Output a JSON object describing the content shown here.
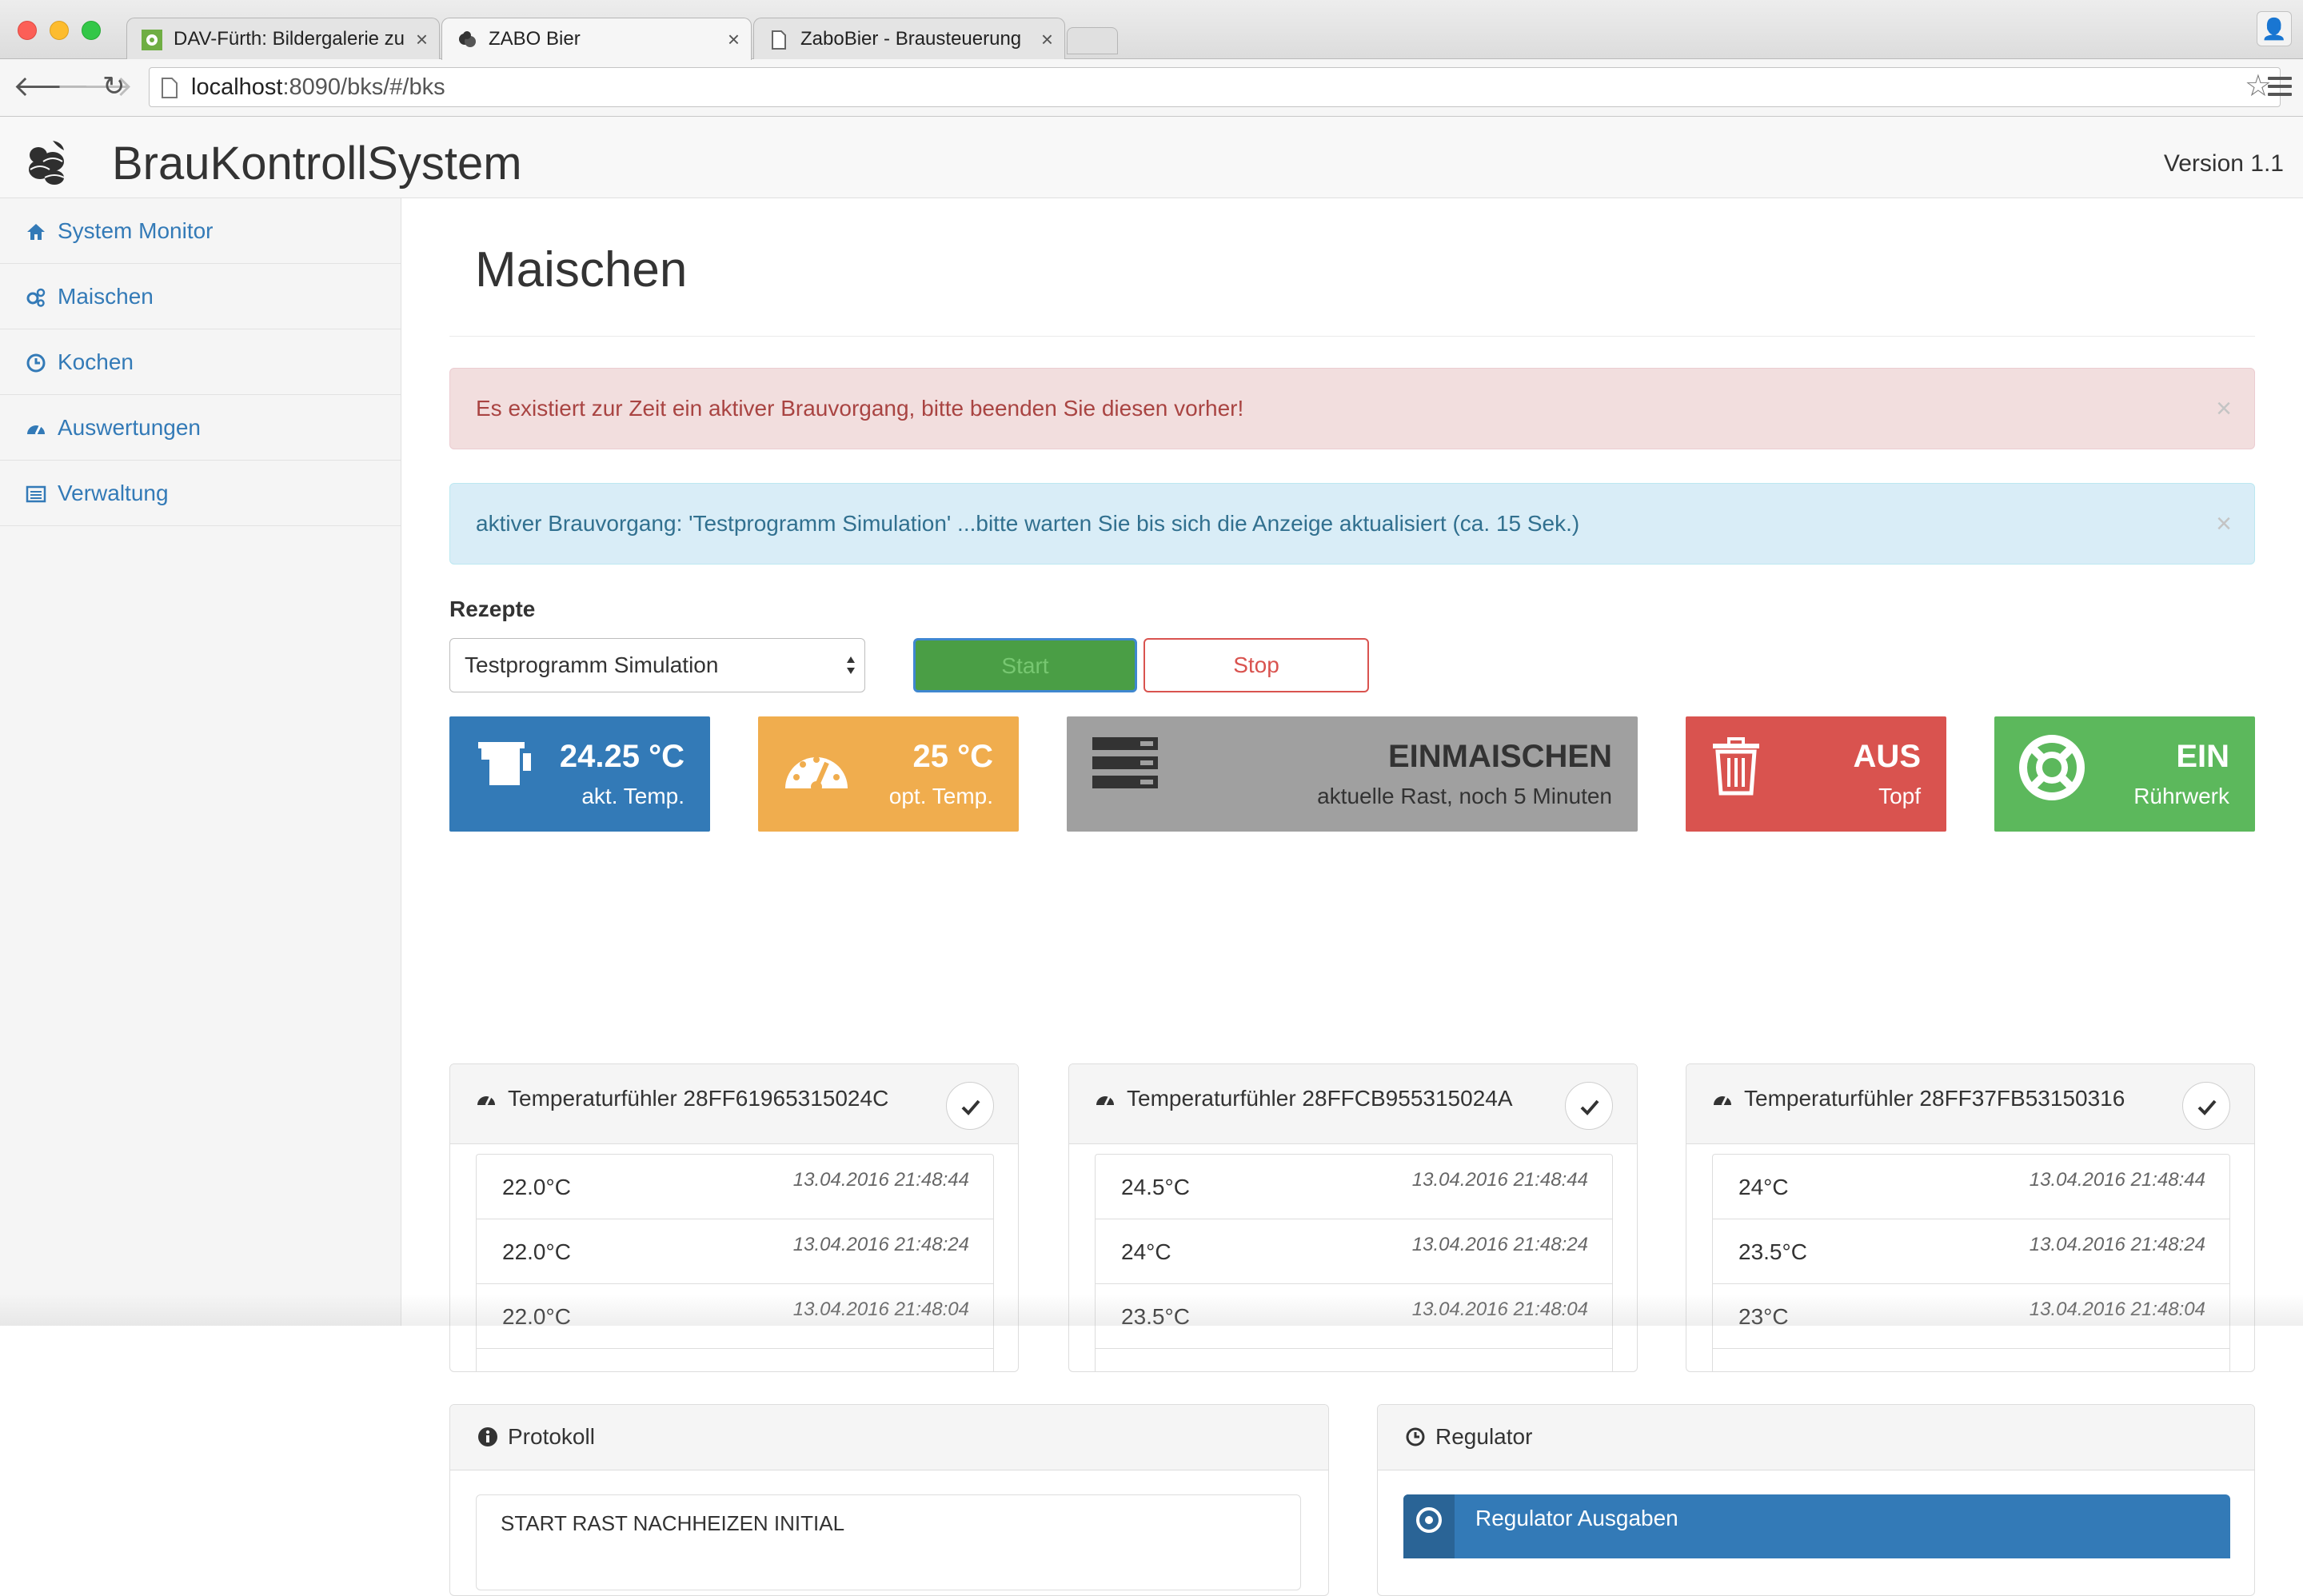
{
  "browser": {
    "tabs": [
      {
        "title": "DAV-Fürth: Bildergalerie zu"
      },
      {
        "title": "ZABO Bier"
      },
      {
        "title": "ZaboBier - Brausteuerung"
      }
    ],
    "url_host": "localhost",
    "url_rest": ":8090/bks/#/bks"
  },
  "app": {
    "title": "BrauKontrollSystem",
    "version": "Version 1.1"
  },
  "sidebar": {
    "items": [
      {
        "label": "System Monitor"
      },
      {
        "label": "Maischen"
      },
      {
        "label": "Kochen"
      },
      {
        "label": "Auswertungen"
      },
      {
        "label": "Verwaltung"
      }
    ]
  },
  "main": {
    "title": "Maischen",
    "alert_danger": "Es existiert zur Zeit ein aktiver Brauvorgang, bitte beenden Sie diesen vorher!",
    "alert_info": "aktiver Brauvorgang: 'Testprogramm Simulation' ...bitte warten Sie bis sich die Anzeige aktualisiert (ca. 15 Sek.)",
    "close_symbol": "×",
    "recipes_label": "Rezepte",
    "recipe_selected": "Testprogramm Simulation",
    "start_label": "Start",
    "stop_label": "Stop"
  },
  "tiles": {
    "current_temp": {
      "value": "24.25 °C",
      "label": "akt. Temp."
    },
    "optimal_temp": {
      "value": "25 °C",
      "label": "opt. Temp."
    },
    "phase": {
      "value": "EINMAISCHEN",
      "label": "aktuelle Rast, noch 5 Minuten"
    },
    "pot": {
      "value": "AUS",
      "label": "Topf"
    },
    "stirrer": {
      "value": "EIN",
      "label": "Rührwerk"
    }
  },
  "sensors": [
    {
      "title": "Temperaturfühler 28FF61965315024C",
      "readings": [
        {
          "temp": "22.0°C",
          "time": "13.04.2016 21:48:44"
        },
        {
          "temp": "22.0°C",
          "time": "13.04.2016 21:48:24"
        },
        {
          "temp": "22.0°C",
          "time": "13.04.2016 21:48:04"
        }
      ]
    },
    {
      "title": "Temperaturfühler 28FFCB955315024A",
      "readings": [
        {
          "temp": "24.5°C",
          "time": "13.04.2016 21:48:44"
        },
        {
          "temp": "24°C",
          "time": "13.04.2016 21:48:24"
        },
        {
          "temp": "23.5°C",
          "time": "13.04.2016 21:48:04"
        }
      ]
    },
    {
      "title": "Temperaturfühler 28FF37FB53150316",
      "readings": [
        {
          "temp": "24°C",
          "time": "13.04.2016 21:48:44"
        },
        {
          "temp": "23.5°C",
          "time": "13.04.2016 21:48:24"
        },
        {
          "temp": "23°C",
          "time": "13.04.2016 21:48:04"
        }
      ]
    }
  ],
  "protocol": {
    "title": "Protokoll",
    "first_entry": "START RAST NACHHEIZEN INITIAL"
  },
  "regulator": {
    "title": "Regulator",
    "outputs_label": "Regulator Ausgaben"
  },
  "colors": {
    "primary": "#337ab7",
    "warning": "#f0ad4e",
    "danger": "#d9534f",
    "success": "#5cb85c",
    "neutral": "#a0a0a0"
  }
}
